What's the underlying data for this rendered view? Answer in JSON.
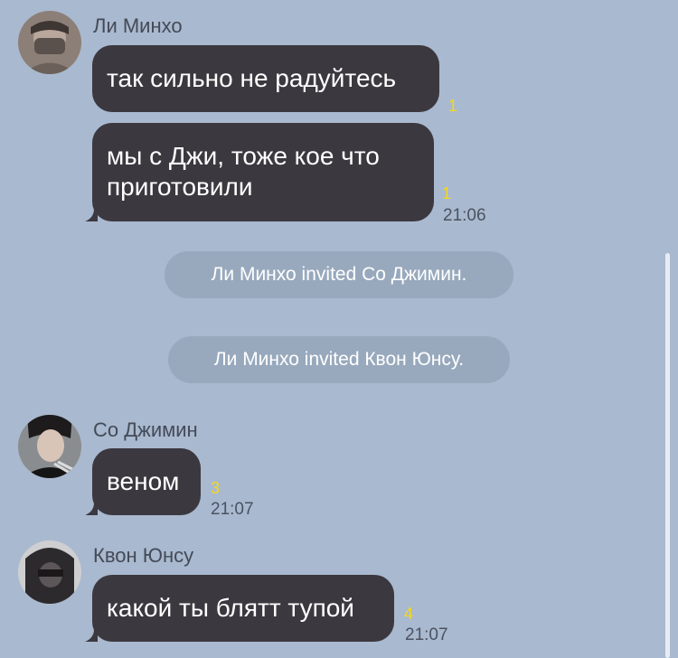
{
  "messages_group_1": {
    "sender": "Ли Минхо",
    "avatar_icon": "user-avatar-photo",
    "messages": [
      {
        "text": "так сильно не радуйтесь",
        "count": "1"
      },
      {
        "text_line1": "мы с Джи, тоже кое что",
        "text_line2": "приготовили",
        "count": "1",
        "time": "21:06"
      }
    ]
  },
  "system_messages": [
    {
      "text": "Ли Минхо invited Со Джимин."
    },
    {
      "text": "Ли Минхо invited Квон Юнсу."
    }
  ],
  "messages_group_2": {
    "sender": "Со Джимин",
    "avatar_icon": "user-avatar-photo",
    "message": {
      "text": "веном",
      "count": "3",
      "time": "21:07"
    }
  },
  "messages_group_3": {
    "sender": "Квон Юнсу",
    "avatar_icon": "user-avatar-photo",
    "message": {
      "text": "какой ты блятт тупой",
      "count": "4",
      "time": "21:07"
    }
  },
  "colors": {
    "background": "#a9b9cf",
    "bubble": "#3b383f",
    "system_pill": "#98a9bd",
    "reaction_count": "#f4d81e"
  }
}
